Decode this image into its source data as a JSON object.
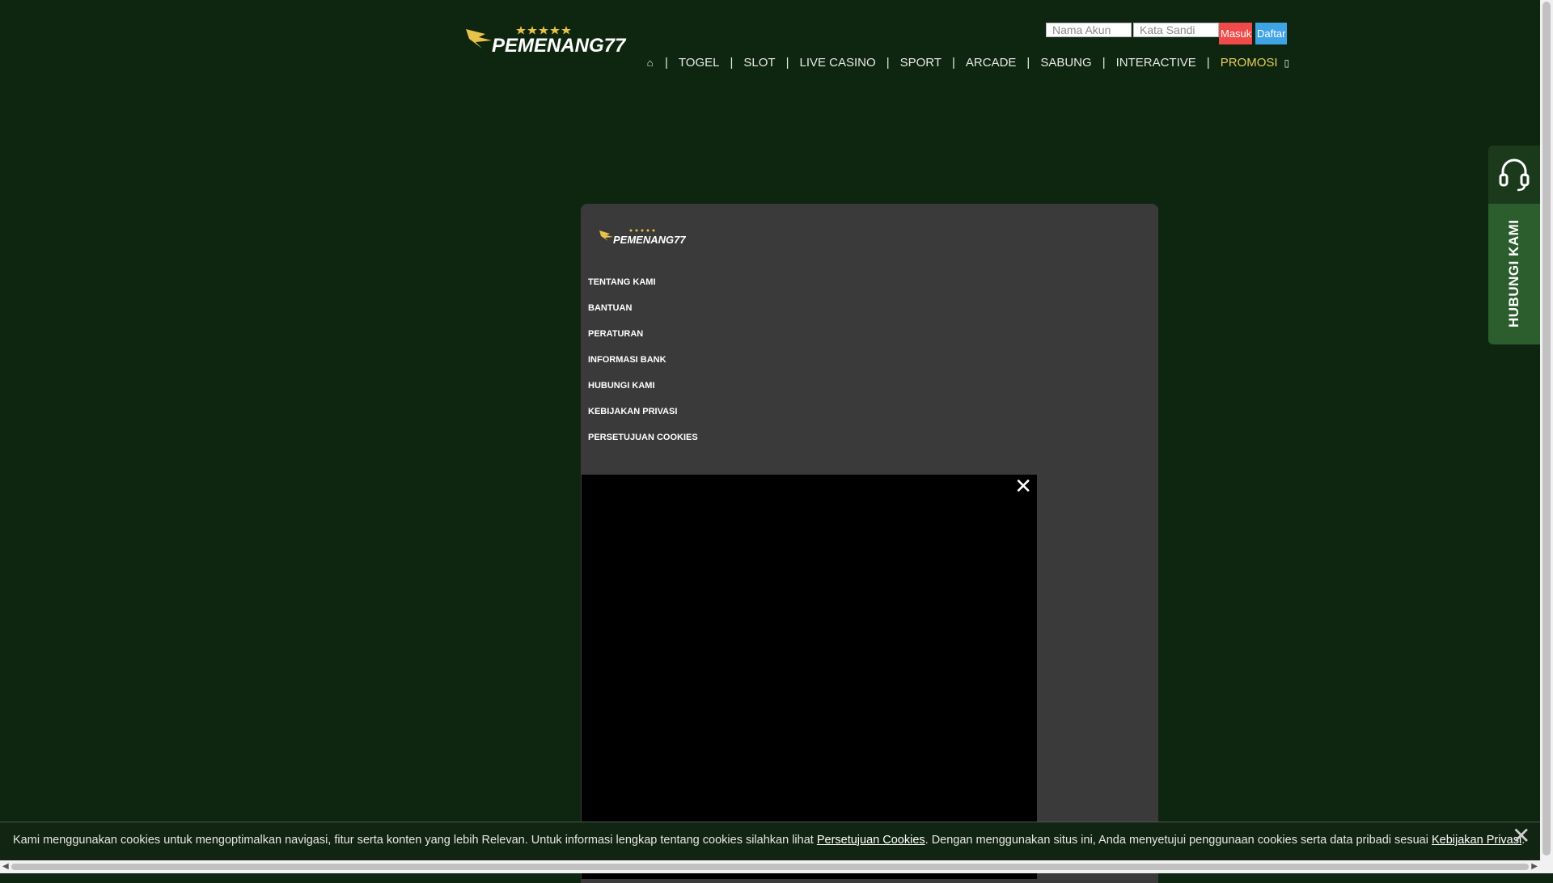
{
  "header": {
    "logo_text": "PEMENANG77",
    "login": {
      "username_placeholder": "Nama Akun",
      "password_placeholder": "Kata Sandi",
      "login_label": "Masuk",
      "register_label": "Daftar"
    },
    "nav": {
      "home_icon": "home-icon",
      "items": [
        "TOGEL",
        "SLOT",
        "LIVE CASINO",
        "SPORT",
        "ARCADE",
        "SABUNG",
        "INTERACTIVE"
      ],
      "promo": "PROMOSI",
      "separator": "|"
    }
  },
  "contact_widget": {
    "icon": "headset-icon",
    "label": "HUBUNGI KAMI"
  },
  "panel": {
    "logo_text": "PEMENANG77",
    "menu": [
      "TENTANG KAMI",
      "BANTUAN",
      "PERATURAN",
      "INFORMASI BANK",
      "HUBUNGI KAMI",
      "KEBIJAKAN PRIVASI",
      "PERSETUJUAN COOKIES"
    ]
  },
  "video_overlay": {
    "close_icon": "close-icon"
  },
  "cookie_bar": {
    "text_before": "Kami menggunakan cookies untuk mengoptimalkan navigasi, fitur serta konten yang lebih Relevan. Untuk informasi lengkap tentang cookies silahkan lihat ",
    "link1": "Persetujuan Cookies",
    "text_middle": ". Dengan menggunakan situs ini, Anda menyetujui penggunaan cookies serta data pribadi sesuai ",
    "link2": "Kebijakan Privasi",
    "text_after": "."
  },
  "colors": {
    "background": "#0e260f",
    "panel": "#3a3a3a",
    "login_button": "#f04a4a",
    "register_button": "#3fa4e6",
    "promo": "#e6cc5a",
    "logo_gold": "#e8c24a"
  }
}
